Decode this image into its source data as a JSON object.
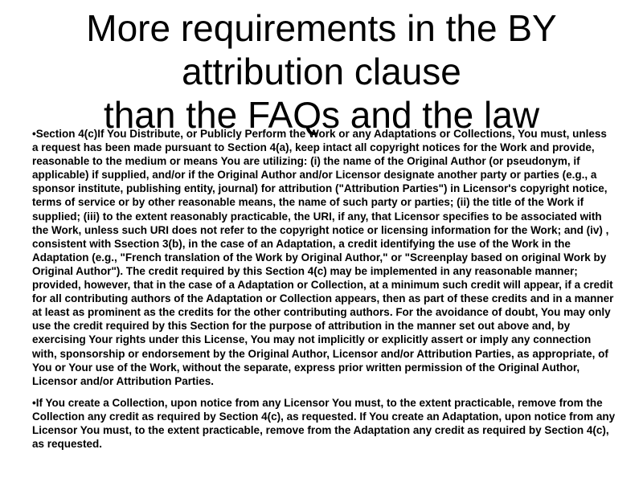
{
  "slide": {
    "title_lines": [
      "More requirements in the BY",
      "attribution clause",
      "than the FAQs and the law"
    ],
    "bullets": [
      "Section 4(c)If You Distribute, or Publicly Perform the Work or any Adaptations or Collections, You must, unless a request has been made pursuant to Section 4(a), keep intact all copyright notices for the Work and provide, reasonable to the medium or means You are utilizing: (i) the name of the Original Author (or pseudonym, if applicable) if supplied, and/or if the Original Author and/or Licensor designate another party or parties (e.g., a sponsor institute, publishing entity, journal) for attribution (\"Attribution Parties\") in Licensor's copyright notice, terms of service or by other reasonable means, the name of such party or parties; (ii) the title of the Work if supplied; (iii) to the extent reasonably practicable, the URI, if any, that Licensor specifies to be associated with the Work, unless such URI does not refer to the copyright notice or licensing information for the Work; and (iv) , consistent with Ssection 3(b), in the case of an Adaptation, a credit identifying the use of the Work in the Adaptation (e.g., \"French translation of the Work by Original Author,\" or \"Screenplay based on original Work by Original Author\"). The credit required by this Section 4(c) may be implemented in any reasonable manner; provided, however, that in the case of a Adaptation or Collection, at a minimum such credit will appear, if a credit for all contributing authors of the Adaptation or Collection appears, then as part of these credits and in a manner at least as prominent as the credits for the other contributing authors. For the avoidance of doubt, You may only use the credit required by this Section for the purpose of attribution in the manner set out above and, by exercising Your rights under this License, You may not implicitly or explicitly assert or imply any connection with, sponsorship or endorsement by the Original Author, Licensor and/or Attribution Parties, as appropriate, of You or Your use of the Work, without the separate, express prior written permission of the Original Author, Licensor and/or Attribution Parties.",
      "If You create a Collection, upon notice from any Licensor You must, to the extent practicable, remove from the Collection any credit as required by Section 4(c), as requested. If You create an Adaptation, upon notice from any Licensor You must, to the extent practicable, remove from the Adaptation any credit as required by Section 4(c), as requested."
    ]
  }
}
